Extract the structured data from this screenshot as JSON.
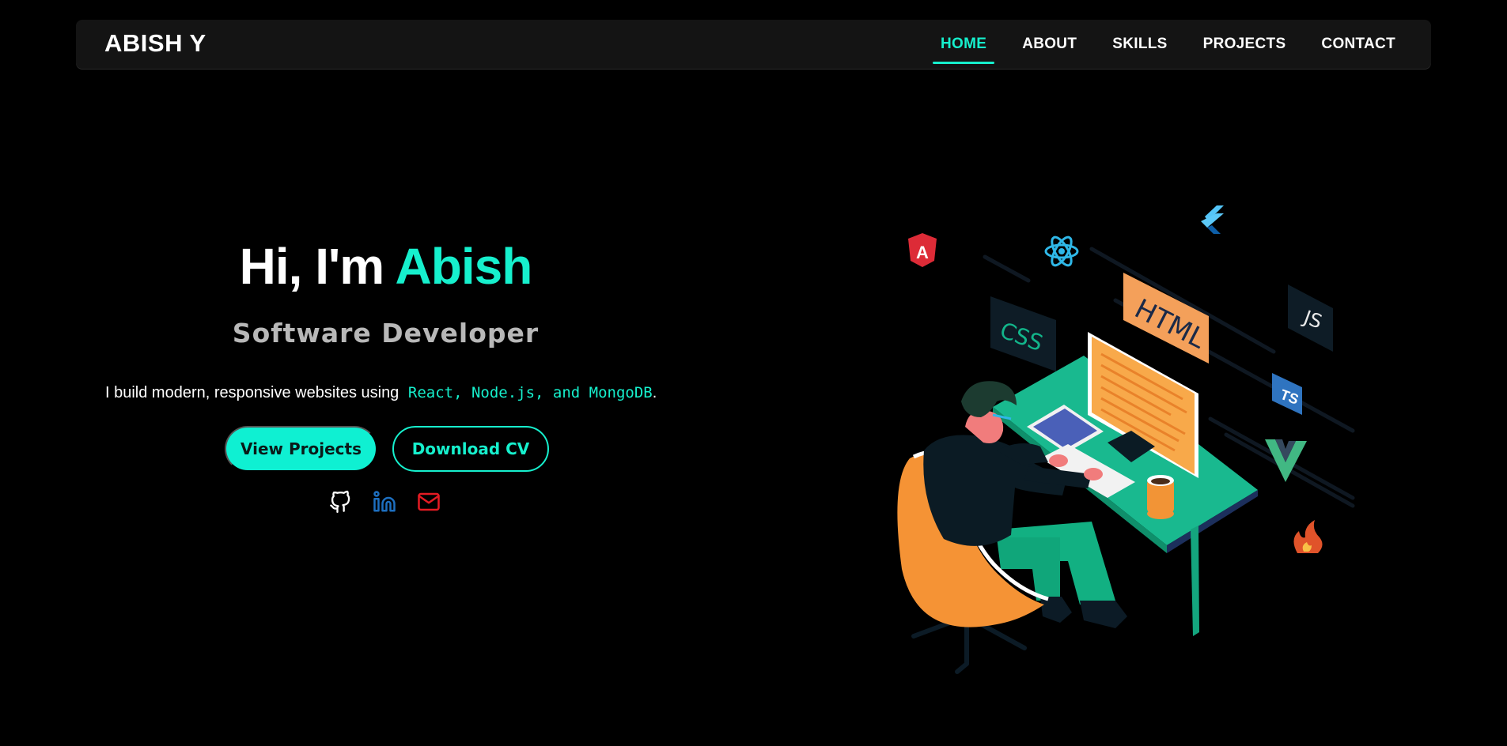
{
  "nav": {
    "logo": "ABISH Y",
    "links": [
      {
        "label": "HOME",
        "active": true
      },
      {
        "label": "ABOUT",
        "active": false
      },
      {
        "label": "SKILLS",
        "active": false
      },
      {
        "label": "PROJECTS",
        "active": false
      },
      {
        "label": "CONTACT",
        "active": false
      }
    ]
  },
  "hero": {
    "greeting_prefix": "Hi, I'm ",
    "greeting_name": "Abish",
    "role": "Software Developer",
    "tagline_text": "I build modern, responsive websites using ",
    "tagline_tech": "React, Node.js, and MongoDB",
    "tagline_end": ".",
    "buttons": {
      "primary": "View Projects",
      "secondary": "Download CV"
    },
    "socials": [
      "github-icon",
      "linkedin-icon",
      "mail-icon"
    ]
  },
  "illustration": {
    "labels": {
      "html": "HTML",
      "css": "CSS",
      "js": "JS",
      "ts": "TS"
    }
  },
  "colors": {
    "accent": "#16f0cd",
    "background": "#000000",
    "navbar": "#141414",
    "role_text": "#b8b8b8",
    "linkedin": "#1d6fc0",
    "mail": "#e41b23"
  }
}
